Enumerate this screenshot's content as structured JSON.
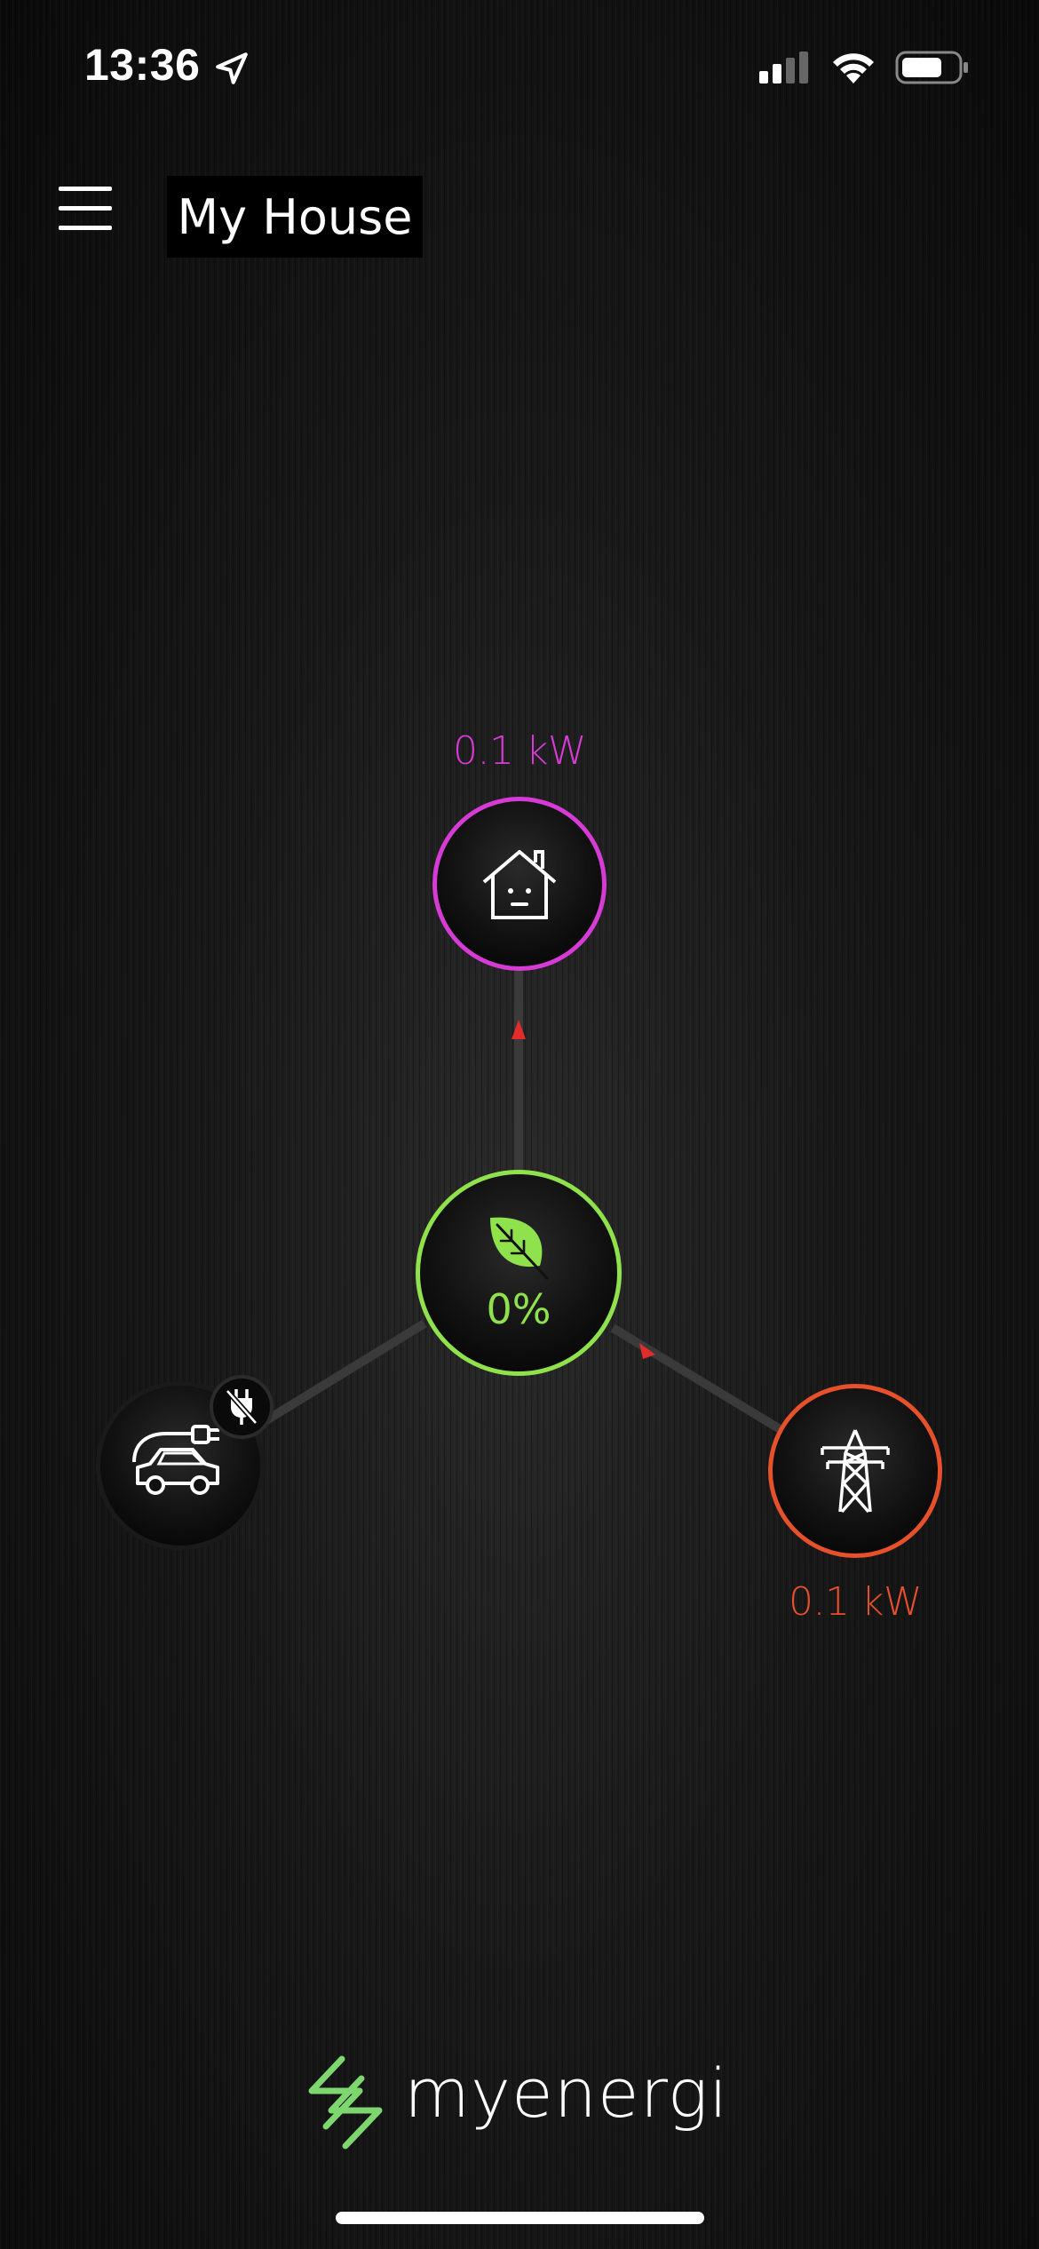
{
  "status_bar": {
    "time": "13:36",
    "icons": [
      "location-arrow-icon",
      "cellular-signal-icon",
      "wifi-icon",
      "battery-icon"
    ]
  },
  "header": {
    "menu_icon": "hamburger-menu-icon",
    "title": "My House"
  },
  "flow": {
    "house": {
      "value": "0.1 kW",
      "icon": "house-icon",
      "color": "#d63bd6"
    },
    "green": {
      "value": "0%",
      "icon": "leaf-icon",
      "color": "#8fe24b"
    },
    "ev": {
      "icon": "electric-car-icon",
      "badge_icon": "unplugged-icon"
    },
    "grid": {
      "value": "0.1 kW",
      "icon": "pylon-icon",
      "color": "#e6502a"
    }
  },
  "logo": {
    "text": "myenergi",
    "icon": "myenergi-logo-icon",
    "color": "#7ed66f"
  }
}
